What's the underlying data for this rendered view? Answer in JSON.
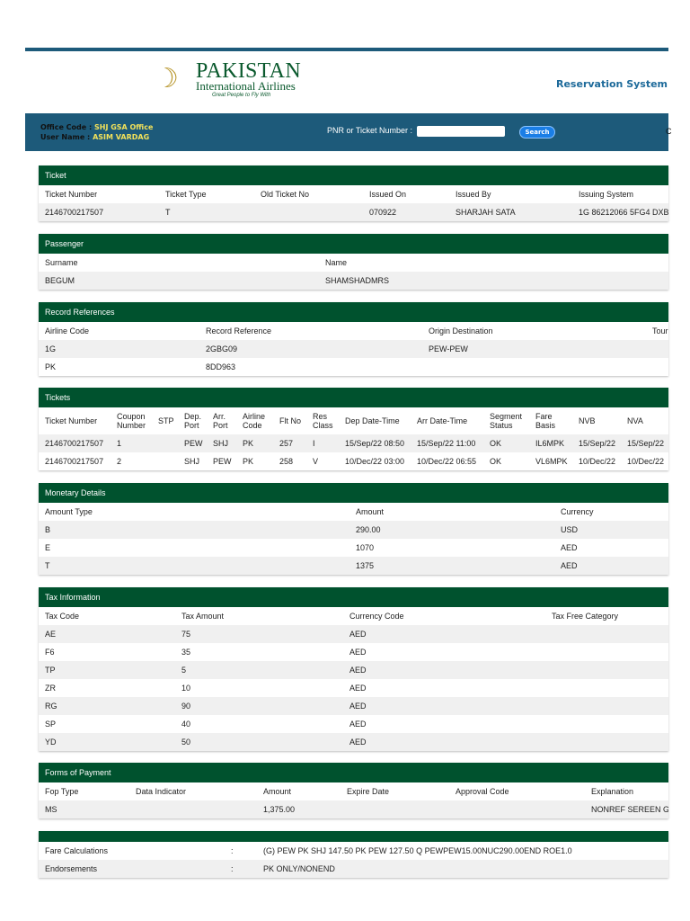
{
  "header": {
    "brand_name": "PAKISTAN",
    "brand_sub": "International Airlines",
    "brand_tagline": "Great People to Fly With",
    "system_title": "Reservation System",
    "office_code_label": "Office Code :",
    "office_code": "SHJ GSA Office",
    "user_name_label": "User Name :",
    "user_name": "ASIM VARDAG",
    "pnr_label": "PNR or Ticket Number :",
    "pnr_value": "",
    "search_label": "Search",
    "cut_text": "C"
  },
  "colors": {
    "nav": "#1d5a7a",
    "section_header": "#00522e",
    "accent": "#f2e15a"
  },
  "sections": [
    {
      "id": "ticket",
      "title": "Ticket",
      "columns": [
        "Ticket Number",
        "Ticket Type",
        "Old Ticket No",
        "Issued On",
        "Issued By",
        "Issuing System"
      ],
      "rows": [
        [
          "2146700217507",
          "T",
          "",
          "070922",
          "SHARJAH SATA",
          "1G 86212066 5FG4 DXB"
        ]
      ]
    },
    {
      "id": "passenger",
      "title": "Passenger",
      "columns": [
        "Surname",
        "Name"
      ],
      "rows": [
        [
          "BEGUM",
          "SHAMSHADMRS"
        ]
      ]
    },
    {
      "id": "record-references",
      "title": "Record References",
      "columns": [
        "Airline Code",
        "Record Reference",
        "Origin Destination",
        "Tour"
      ],
      "rows": [
        [
          "1G",
          "2GBG09",
          "PEW-PEW",
          ""
        ],
        [
          "PK",
          "8DD963",
          "",
          ""
        ]
      ]
    },
    {
      "id": "tickets",
      "title": "Tickets",
      "columns": [
        "Ticket Number",
        "Coupon Number",
        "STP",
        "Dep. Port",
        "Arr. Port",
        "Airline Code",
        "Flt No",
        "Res Class",
        "Dep Date-Time",
        "Arr Date-Time",
        "Segment Status",
        "Fare Basis",
        "NVB",
        "NVA"
      ],
      "rows": [
        [
          "2146700217507",
          "1",
          "",
          "PEW",
          "SHJ",
          "PK",
          "257",
          "I",
          "15/Sep/22 08:50",
          "15/Sep/22 11:00",
          "OK",
          "IL6MPK",
          "15/Sep/22",
          "15/Sep/22"
        ],
        [
          "2146700217507",
          "2",
          "",
          "SHJ",
          "PEW",
          "PK",
          "258",
          "V",
          "10/Dec/22 03:00",
          "10/Dec/22 06:55",
          "OK",
          "VL6MPK",
          "10/Dec/22",
          "10/Dec/22"
        ]
      ]
    },
    {
      "id": "monetary-details",
      "title": "Monetary Details",
      "columns": [
        "Amount Type",
        "Amount",
        "Currency"
      ],
      "rows": [
        [
          "B",
          "290.00",
          "USD"
        ],
        [
          "E",
          "1070",
          "AED"
        ],
        [
          "T",
          "1375",
          "AED"
        ]
      ]
    },
    {
      "id": "tax-information",
      "title": "Tax Information",
      "columns": [
        "Tax Code",
        "Tax Amount",
        "Currency Code",
        "Tax Free Category"
      ],
      "rows": [
        [
          "AE",
          "75",
          "AED",
          ""
        ],
        [
          "F6",
          "35",
          "AED",
          ""
        ],
        [
          "TP",
          "5",
          "AED",
          ""
        ],
        [
          "ZR",
          "10",
          "AED",
          ""
        ],
        [
          "RG",
          "90",
          "AED",
          ""
        ],
        [
          "SP",
          "40",
          "AED",
          ""
        ],
        [
          "YD",
          "50",
          "AED",
          ""
        ]
      ]
    },
    {
      "id": "forms-of-payment",
      "title": "Forms of Payment",
      "columns": [
        "Fop Type",
        "Data Indicator",
        "Amount",
        "Expire Date",
        "Approval Code",
        "Explanation"
      ],
      "rows": [
        [
          "MS",
          "",
          "1,375.00",
          "",
          "",
          "NONREF SEREEN G"
        ]
      ]
    },
    {
      "id": "fare-info",
      "title": "",
      "columns": null,
      "rows": [
        [
          "Fare Calculations",
          ":",
          "(G) PEW PK SHJ 147.50 PK PEW 127.50 Q PEWPEW15.00NUC290.00END ROE1.0"
        ],
        [
          "Endorsements",
          ":",
          "PK ONLY/NONEND"
        ]
      ]
    }
  ]
}
